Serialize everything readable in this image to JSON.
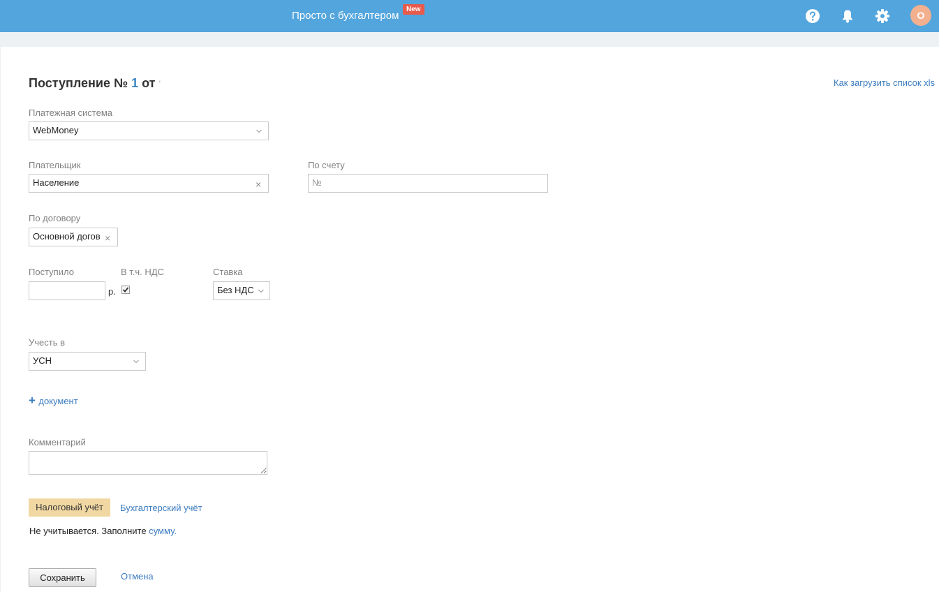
{
  "header": {
    "brand": "Просто с бухгалтером",
    "new_badge": "New",
    "avatar_letter": "О",
    "icons": [
      "help-icon",
      "bell-icon",
      "gear-icon"
    ]
  },
  "form": {
    "title_prefix": "Поступление №",
    "number": "1",
    "title_suffix": "от",
    "title_trail": "'",
    "help_link": "Как загрузить список xls",
    "payment_system": {
      "label": "Платежная система",
      "value": "WebMoney"
    },
    "payer": {
      "label": "Плательщик",
      "value": "Население"
    },
    "invoice": {
      "label": "По счету",
      "placeholder": "№"
    },
    "contract": {
      "label": "По договору",
      "value": "Основной догов"
    },
    "received": {
      "label": "Поступило",
      "value": "",
      "currency": "р."
    },
    "vat_included": {
      "label": "В т.ч. НДС",
      "checked": true
    },
    "rate": {
      "label": "Ставка",
      "value": "Без НДС"
    },
    "account_in": {
      "label": "Учесть в",
      "value": "УСН"
    },
    "add_document": "документ",
    "comment": {
      "label": "Комментарий",
      "value": ""
    },
    "tabs": [
      "Налоговый учёт",
      "Бухгалтерский учёт"
    ],
    "tax_note_prefix": "Не учитывается. Заполните",
    "tax_note_link": "сумму.",
    "save_label": "Сохранить",
    "cancel_label": "Отмена"
  },
  "colors": {
    "topbar": "#53a5dd",
    "accent": "#3a7bbf",
    "tab_active": "#f1d8a3",
    "badge": "#e85a4a",
    "avatar": "#f3b08f"
  }
}
